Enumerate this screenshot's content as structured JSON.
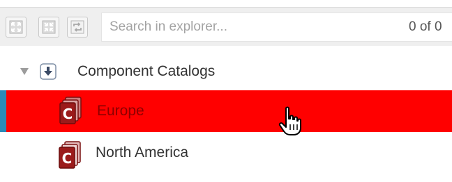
{
  "toolbar": {
    "buttons": [
      {
        "icon": "expand-all-icon"
      },
      {
        "icon": "collapse-all-icon"
      },
      {
        "icon": "sync-icon"
      }
    ],
    "search": {
      "placeholder": "Search in explorer...",
      "value": "",
      "count": "0 of 0"
    }
  },
  "tree": {
    "root": {
      "label": "Component Catalogs",
      "expanded": true,
      "icon": "catalog-root-icon"
    },
    "items": [
      {
        "label": "Europe",
        "selected": true,
        "icon": "catalog-icon"
      },
      {
        "label": "North America",
        "selected": false,
        "icon": "catalog-icon"
      }
    ]
  },
  "colors": {
    "selected_row": "#ff0000",
    "selected_accent": "#2b8ab8",
    "selected_text": "#8c0000",
    "catalog_icon": "#9b1b1b"
  }
}
